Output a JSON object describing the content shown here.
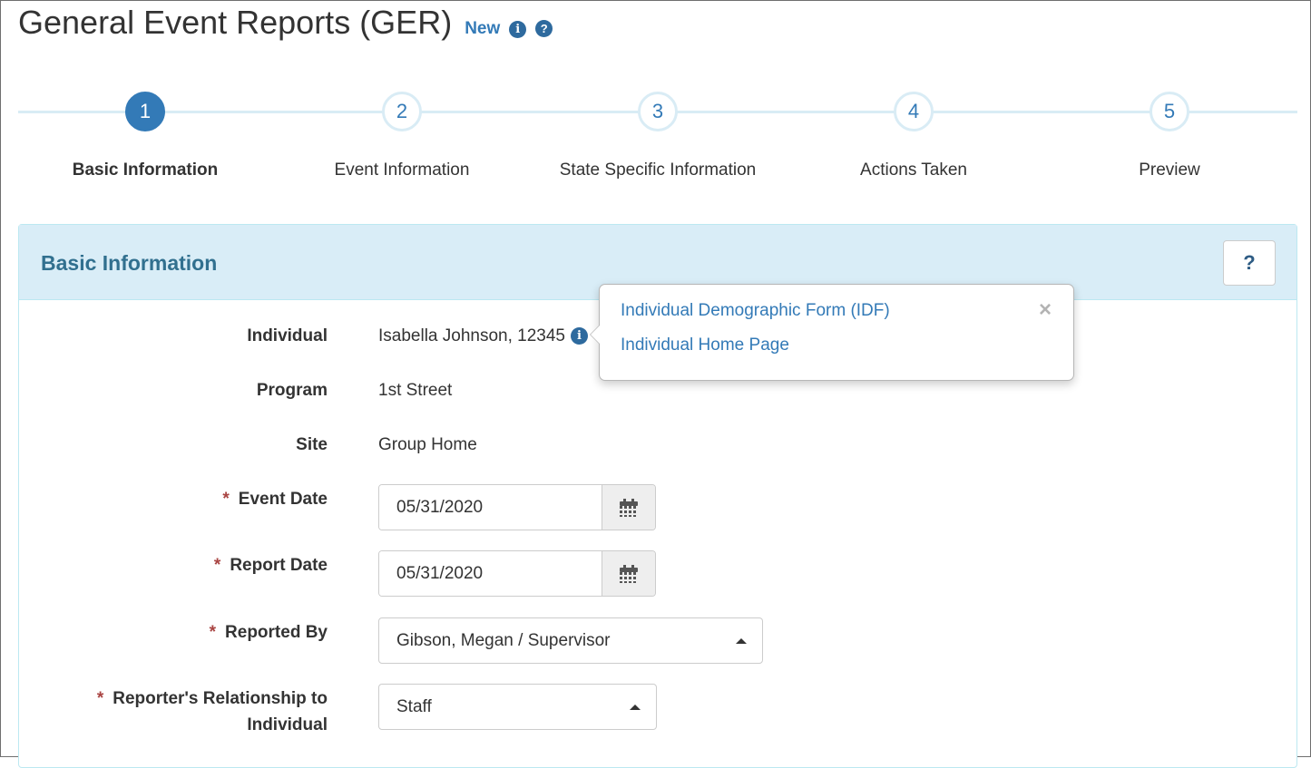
{
  "header": {
    "title": "General Event Reports (GER)",
    "new_label": "New",
    "info_icon": "info-circle-icon",
    "help_icon": "question-circle-icon"
  },
  "steps": [
    {
      "number": "1",
      "label": "Basic Information",
      "active": true
    },
    {
      "number": "2",
      "label": "Event Information",
      "active": false
    },
    {
      "number": "3",
      "label": "State Specific Information",
      "active": false
    },
    {
      "number": "4",
      "label": "Actions Taken",
      "active": false
    },
    {
      "number": "5",
      "label": "Preview",
      "active": false
    }
  ],
  "panel": {
    "title": "Basic Information",
    "help_label": "?"
  },
  "form": {
    "individual_label": "Individual",
    "individual_value": "Isabella Johnson, 12345",
    "program_label": "Program",
    "program_value": "1st Street",
    "site_label": "Site",
    "site_value": "Group Home",
    "required_marker": "*",
    "event_date_label": "Event Date",
    "event_date_value": "05/31/2020",
    "report_date_label": "Report Date",
    "report_date_value": "05/31/2020",
    "reported_by_label": "Reported By",
    "reported_by_value": "Gibson, Megan / Supervisor",
    "relationship_label_line1": "Reporter's Relationship to",
    "relationship_label_line2": "Individual",
    "relationship_value": "Staff"
  },
  "popover": {
    "link1": "Individual Demographic Form (IDF)",
    "link2": "Individual Home Page",
    "close_label": "×"
  },
  "colors": {
    "accent": "#337ab7",
    "panel_heading_bg": "#d9edf7",
    "panel_title": "#31708f",
    "required": "#a94442"
  }
}
